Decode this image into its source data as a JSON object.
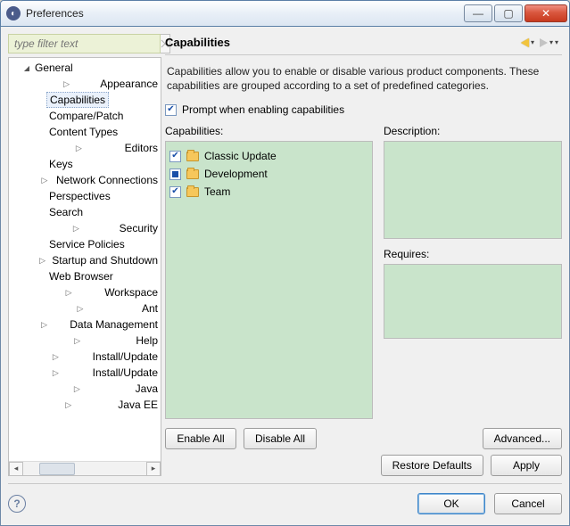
{
  "window": {
    "title": "Preferences"
  },
  "filter": {
    "placeholder": "type filter text"
  },
  "tree": {
    "items": [
      {
        "label": "General",
        "depth": 1,
        "arrow": "down"
      },
      {
        "label": "Appearance",
        "depth": 2,
        "arrow": "right"
      },
      {
        "label": "Capabilities",
        "depth": 2,
        "arrow": "none",
        "selected": true
      },
      {
        "label": "Compare/Patch",
        "depth": 2,
        "arrow": "none"
      },
      {
        "label": "Content Types",
        "depth": 2,
        "arrow": "none"
      },
      {
        "label": "Editors",
        "depth": 2,
        "arrow": "right"
      },
      {
        "label": "Keys",
        "depth": 2,
        "arrow": "none"
      },
      {
        "label": "Network Connections",
        "depth": 2,
        "arrow": "right"
      },
      {
        "label": "Perspectives",
        "depth": 2,
        "arrow": "none"
      },
      {
        "label": "Search",
        "depth": 2,
        "arrow": "none"
      },
      {
        "label": "Security",
        "depth": 2,
        "arrow": "right"
      },
      {
        "label": "Service Policies",
        "depth": 2,
        "arrow": "none"
      },
      {
        "label": "Startup and Shutdown",
        "depth": 2,
        "arrow": "right"
      },
      {
        "label": "Web Browser",
        "depth": 2,
        "arrow": "none"
      },
      {
        "label": "Workspace",
        "depth": 2,
        "arrow": "right"
      },
      {
        "label": "Ant",
        "depth": 1,
        "arrow": "right"
      },
      {
        "label": "Data Management",
        "depth": 1,
        "arrow": "right"
      },
      {
        "label": "Help",
        "depth": 1,
        "arrow": "right"
      },
      {
        "label": "Install/Update",
        "depth": 1,
        "arrow": "right"
      },
      {
        "label": "Install/Update",
        "depth": 1,
        "arrow": "right"
      },
      {
        "label": "Java",
        "depth": 1,
        "arrow": "right"
      },
      {
        "label": "Java EE",
        "depth": 1,
        "arrow": "right"
      }
    ]
  },
  "page": {
    "title": "Capabilities",
    "description": "Capabilities allow you to enable or disable various product components.  These capabilities are grouped according to a set of predefined categories.",
    "prompt_label": "Prompt when enabling capabilities",
    "prompt_checked": true,
    "capabilities_label": "Capabilities:",
    "description_label": "Description:",
    "requires_label": "Requires:",
    "capabilities": [
      {
        "label": "Classic Update",
        "state": "checked"
      },
      {
        "label": "Development",
        "state": "intermediate"
      },
      {
        "label": "Team",
        "state": "checked"
      }
    ],
    "buttons": {
      "enable_all": "Enable All",
      "disable_all": "Disable All",
      "advanced": "Advanced...",
      "restore_defaults": "Restore Defaults",
      "apply": "Apply"
    }
  },
  "footer": {
    "ok": "OK",
    "cancel": "Cancel"
  }
}
